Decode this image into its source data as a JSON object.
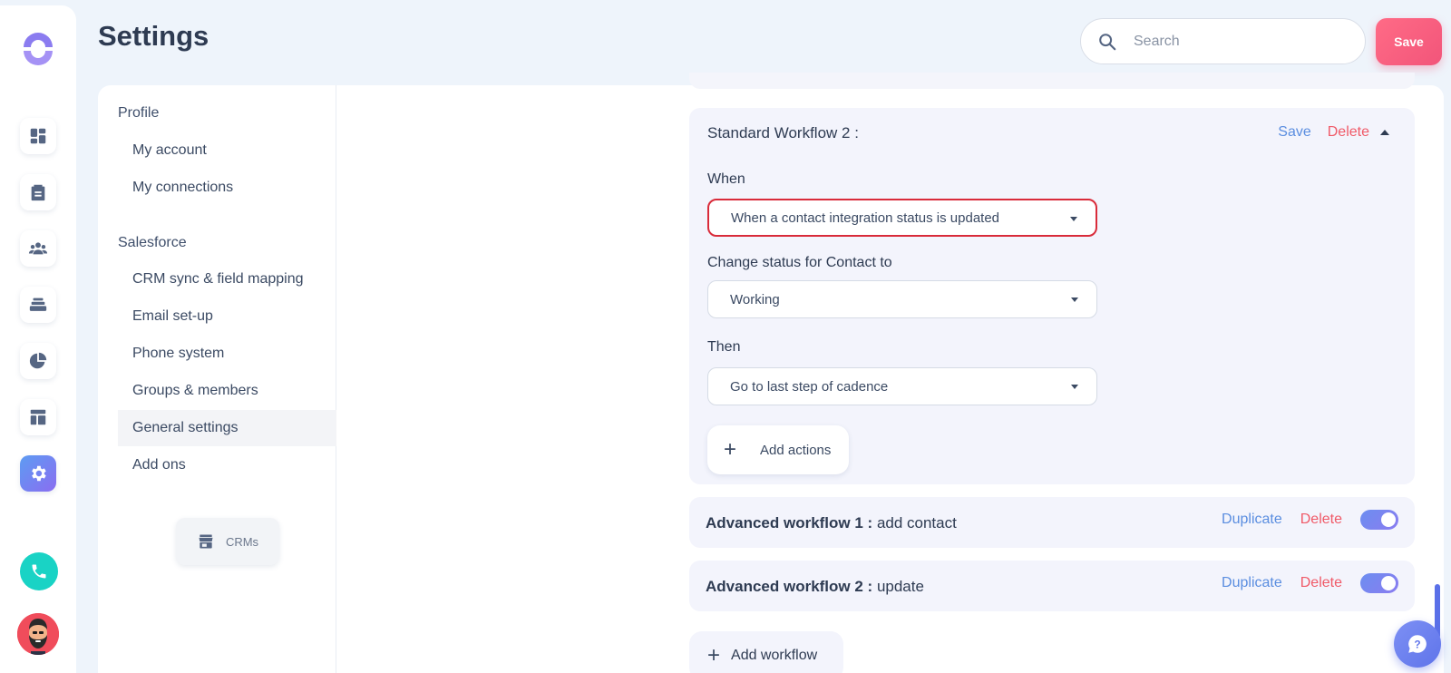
{
  "header": {
    "title": "Settings",
    "search_placeholder": "Search",
    "save_label": "Save"
  },
  "rail": {
    "items": [
      "dashboard-icon",
      "tasks-icon",
      "people-icon",
      "stack-icon",
      "pie-chart-icon",
      "layout-icon",
      "settings-icon"
    ],
    "active": "settings-icon"
  },
  "subnav": {
    "sections": [
      {
        "title": "Profile",
        "items": [
          "My account",
          "My connections"
        ]
      },
      {
        "title": "Salesforce",
        "items": [
          "CRM sync & field mapping",
          "Email set-up",
          "Phone system",
          "Groups & members",
          "General settings",
          "Add ons"
        ]
      }
    ],
    "active_item": "General settings",
    "crms_label": "CRMs"
  },
  "workflows": {
    "expanded": {
      "title": "Standard Workflow 2 :",
      "save_label": "Save",
      "delete_label": "Delete",
      "when_label": "When",
      "when_value": "When a contact integration status is updated",
      "change_label": "Change status for Contact to",
      "change_value": "Working",
      "then_label": "Then",
      "then_value": "Go to last step of cadence",
      "add_actions_label": "Add actions"
    },
    "advanced": [
      {
        "prefix": "Advanced workflow 1 :",
        "name": "add contact",
        "duplicate_label": "Duplicate",
        "delete_label": "Delete",
        "enabled": true
      },
      {
        "prefix": "Advanced workflow 2 :",
        "name": "update",
        "duplicate_label": "Duplicate",
        "delete_label": "Delete",
        "enabled": true
      }
    ],
    "add_workflow_label": "Add workflow"
  },
  "colors": {
    "accent": "#5b8ee0",
    "danger": "#f05a68",
    "save_button": "#f2557a",
    "error_border": "#d92b3a"
  }
}
